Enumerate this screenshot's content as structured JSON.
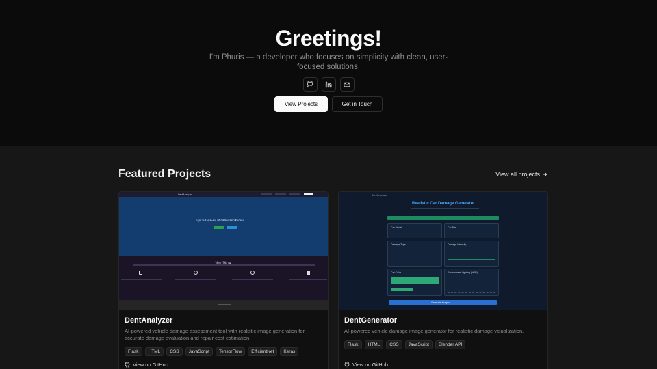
{
  "hero": {
    "title": "Greetings!",
    "intro": "I'm Phuris — a developer who focuses on simplicity with clean, user-focused solutions.",
    "socials": [
      {
        "icon": "github-icon"
      },
      {
        "icon": "linkedin-icon"
      },
      {
        "icon": "mail-icon"
      }
    ],
    "primary_button": "View Projects",
    "secondary_button": "Get in Touch"
  },
  "featured": {
    "heading": "Featured Projects",
    "view_all": "View all projects",
    "projects": [
      {
        "title": "DentAnalyzer",
        "description": "AI-powered vehicle damage assessment tool with realistic image generation for accurate damage evaluation and repair cost estimation.",
        "tags": [
          "Flask",
          "HTML",
          "CSS",
          "JavaScript",
          "TensorFlow",
          "EfficientNet",
          "Keras"
        ],
        "link": "View on GitHub",
        "thumbnail": {
          "nav_title": "DentAnalyzer",
          "hero_text": "กรุณาเข้าสู่ระบบ หรือสมัครสมาชิกก่อน",
          "section_title": "วิธีการใช้งาน"
        }
      },
      {
        "title": "DentGenerator",
        "description": "AI-powered vehicle damage image generator for realistic damage visualization.",
        "tags": [
          "Flask",
          "HTML",
          "CSS",
          "JavaScript",
          "Blender API"
        ],
        "link": "View on GitHub",
        "thumbnail": {
          "nav_title": "DentGenerator",
          "heading": "Realistic Car Damage Generator",
          "panels": [
            "Car Model",
            "Car Part",
            "Damage Type",
            "Damage Intensity",
            "Car Color",
            "Environment Lighting (HDR)"
          ],
          "generate_button": "Generate Images"
        }
      }
    ]
  },
  "colors": {
    "background": "#0b0b0b",
    "section_background": "#171717",
    "primary_button": "#fafafa"
  }
}
